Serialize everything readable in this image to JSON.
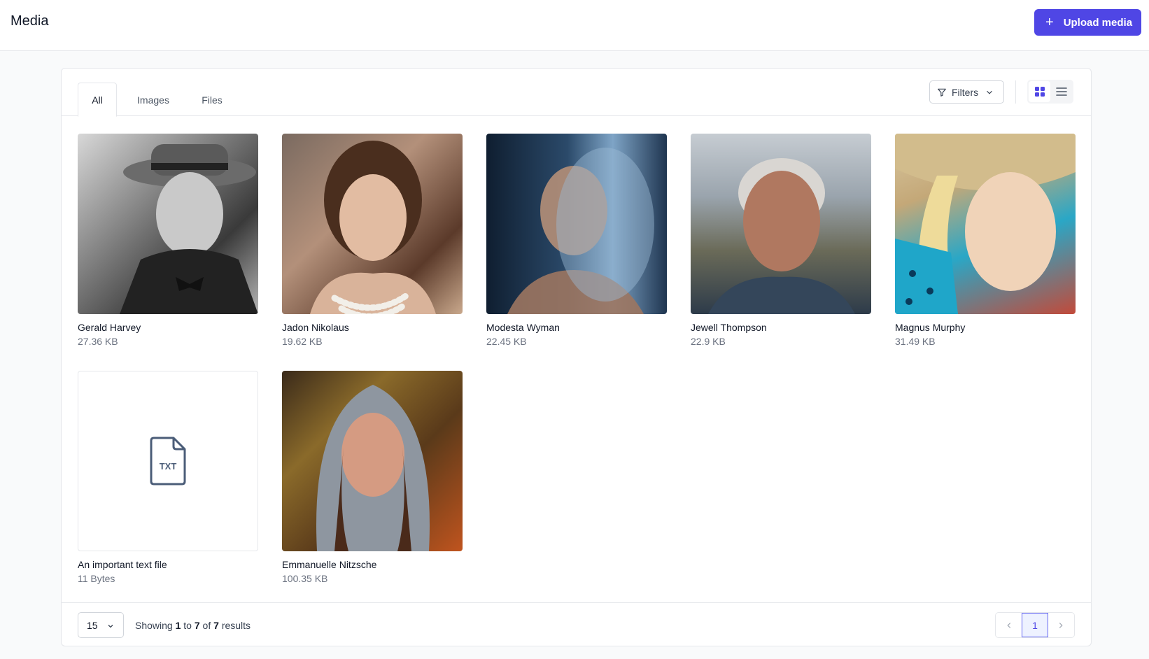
{
  "header": {
    "title": "Media",
    "upload_label": "Upload media"
  },
  "tabs": [
    {
      "label": "All",
      "active": true
    },
    {
      "label": "Images",
      "active": false
    },
    {
      "label": "Files",
      "active": false
    }
  ],
  "toolbar": {
    "filters_label": "Filters",
    "view_mode": "grid"
  },
  "media": [
    {
      "name": "Gerald Harvey",
      "size": "27.36 KB",
      "kind": "image"
    },
    {
      "name": "Jadon Nikolaus",
      "size": "19.62 KB",
      "kind": "image"
    },
    {
      "name": "Modesta Wyman",
      "size": "22.45 KB",
      "kind": "image"
    },
    {
      "name": "Jewell Thompson",
      "size": "22.9 KB",
      "kind": "image"
    },
    {
      "name": "Magnus Murphy",
      "size": "31.49 KB",
      "kind": "image"
    },
    {
      "name": "An important text file",
      "size": "11 Bytes",
      "kind": "file",
      "file_badge": "TXT"
    },
    {
      "name": "Emmanuelle Nitzsche",
      "size": "100.35 KB",
      "kind": "image"
    }
  ],
  "footer": {
    "per_page": "15",
    "showing_prefix": "Showing",
    "from": "1",
    "to_word": "to",
    "to": "7",
    "of_word": "of",
    "total": "7",
    "results_word": "results",
    "current_page": "1"
  },
  "colors": {
    "accent": "#4f46e5"
  }
}
